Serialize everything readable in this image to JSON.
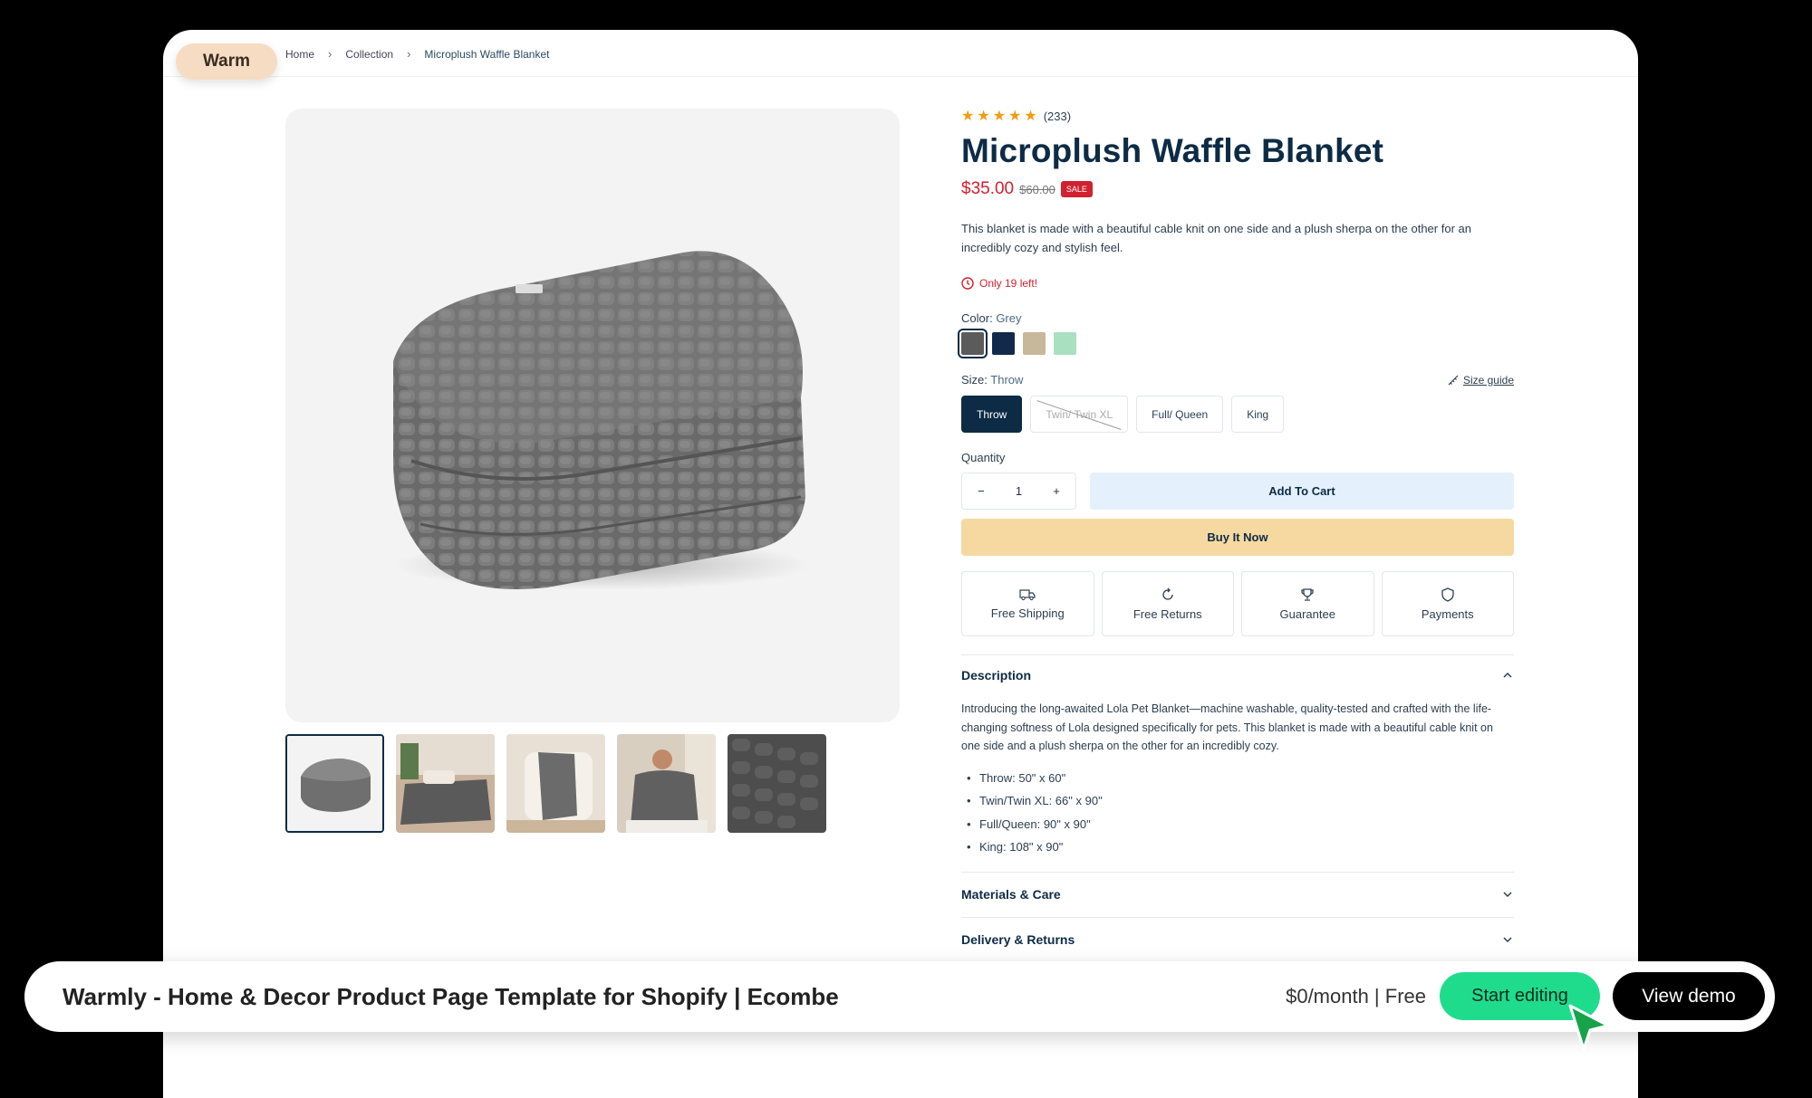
{
  "brand": {
    "pill_label": "Warm"
  },
  "breadcrumb": {
    "items": [
      "Home",
      "Collection",
      "Microplush Waffle Blanket"
    ]
  },
  "product": {
    "review_count": "(233)",
    "rating_stars": 5,
    "title": "Microplush Waffle Blanket",
    "price": "$35.00",
    "compare_price": "$60.00",
    "sale_badge": "SALE",
    "description": "This blanket is made with a beautiful cable knit on one side and a plush sherpa on the other for an incredibly cozy and stylish feel.",
    "stock_text": "Only 19 left!",
    "color_label": "Color:",
    "color_value": "Grey",
    "swatches": [
      "#5b5b5b",
      "#13294b",
      "#c8b89b",
      "#a8e0c0"
    ],
    "size_label": "Size:",
    "size_value": "Throw",
    "size_guide": "Size guide",
    "sizes": [
      "Throw",
      "Twin/ Twin XL",
      "Full/ Queen",
      "King"
    ],
    "quantity_label": "Quantity",
    "quantity_value": "1",
    "add_to_cart": "Add To Cart",
    "buy_now": "Buy It Now",
    "features": [
      "Free Shipping",
      "Free Returns",
      "Guarantee",
      "Payments"
    ]
  },
  "accordion": {
    "description_title": "Description",
    "description_body": "Introducing the long-awaited Lola Pet Blanket—machine washable, quality-tested and crafted with the life-changing softness of Lola designed specifically for pets. This blanket is made with a beautiful cable knit on one side and a plush sherpa on the other for an incredibly cozy.",
    "bullets": [
      "Throw: 50\" x 60\"",
      "Twin/Twin XL: 66\" x 90\"",
      "Full/Queen: 90\" x 90\"",
      "King: 108\" x 90\""
    ],
    "materials_title": "Materials & Care",
    "delivery_title": "Delivery & Returns"
  },
  "banner": {
    "title": "Warmly - Home & Decor Product Page Template for Shopify | Ecombe",
    "price": "$0/month | Free",
    "start_editing": "Start editing",
    "view_demo": "View demo"
  },
  "colors": {
    "navy": "#0d2b45",
    "sale_red": "#d1202f",
    "buy_yellow": "#f5d9a1",
    "cart_blue": "#e4f0fb",
    "cta_green": "#1fdc8d"
  }
}
